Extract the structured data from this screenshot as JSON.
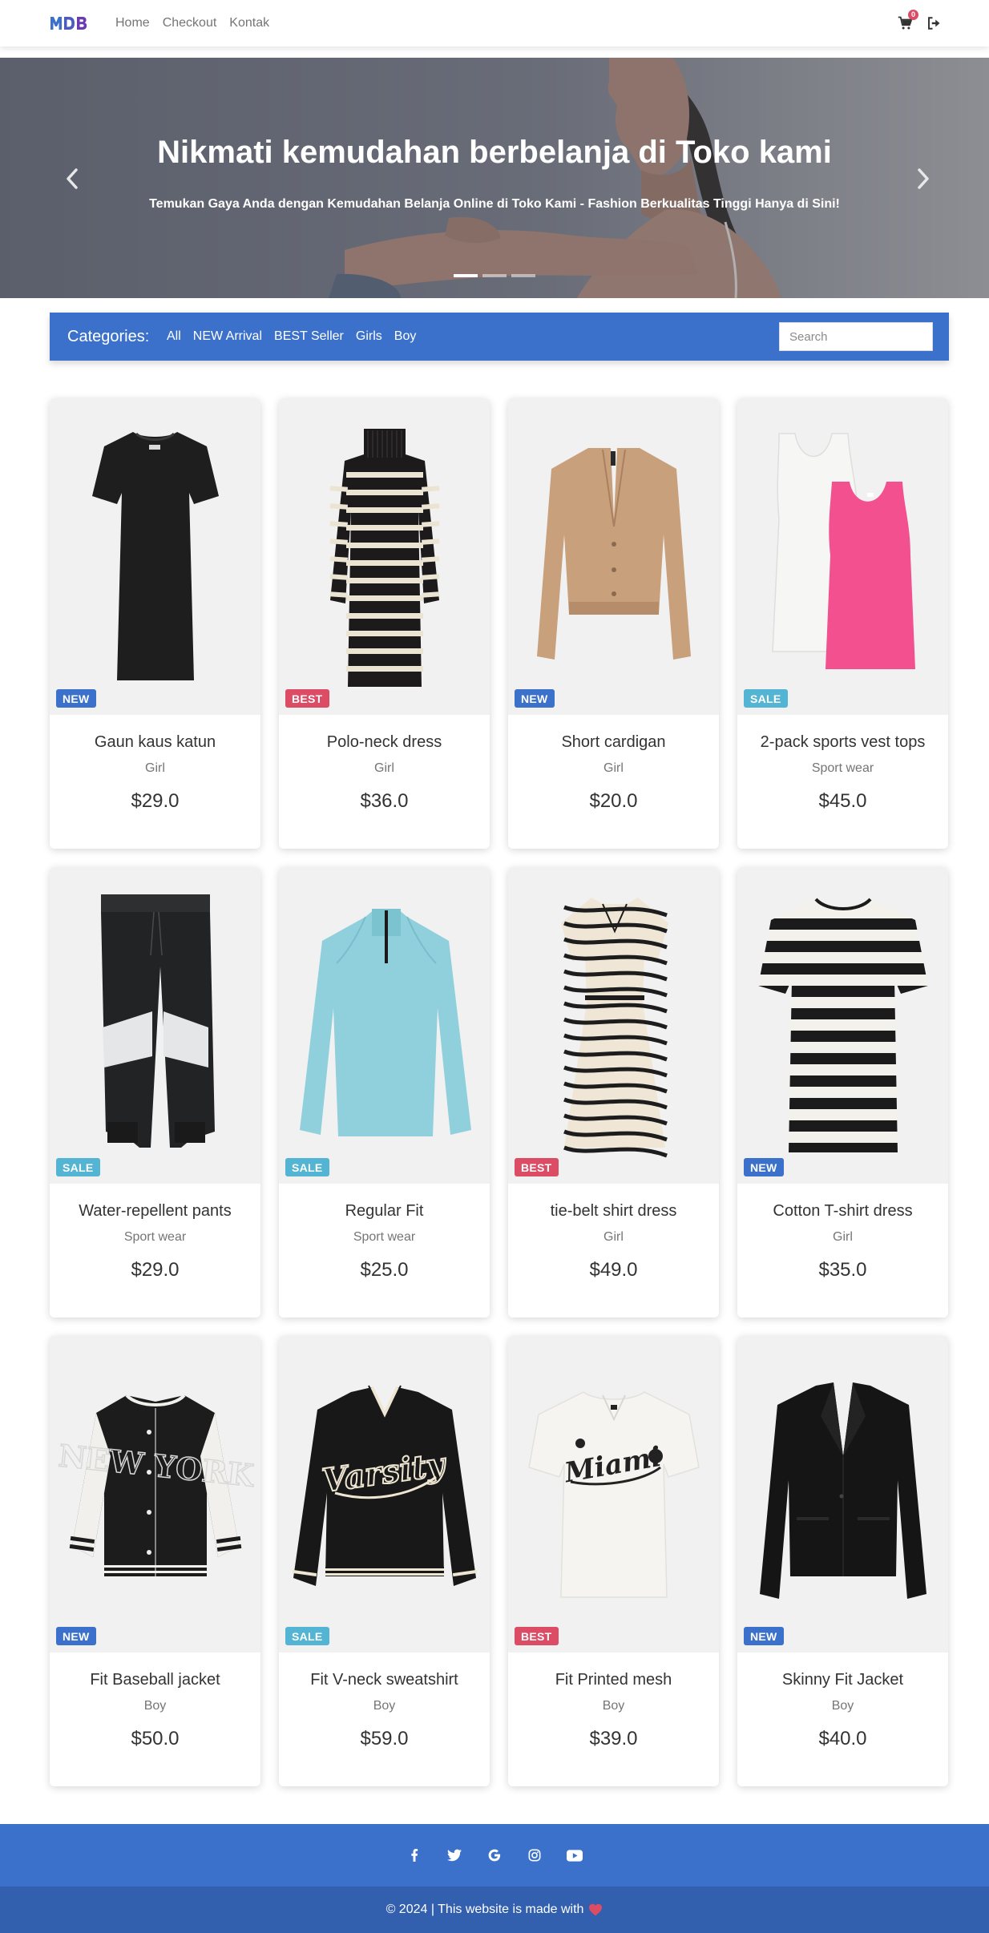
{
  "navbar": {
    "brand": "MDB",
    "links": [
      "Home",
      "Checkout",
      "Kontak"
    ],
    "cart_count": "0"
  },
  "hero": {
    "title": "Nikmati kemudahan berbelanja di Toko kami",
    "subtitle": "Temukan Gaya Anda dengan Kemudahan Belanja Online di Toko Kami - Fashion Berkualitas Tinggi Hanya di Sini!",
    "active_slide": 1,
    "slide_count": 3
  },
  "categories": {
    "label": "Categories:",
    "items": [
      "All",
      "NEW Arrival",
      "BEST Seller",
      "Girls",
      "Boy"
    ],
    "search_placeholder": "Search"
  },
  "badge_colors": {
    "NEW": "#3b71ca",
    "BEST": "#dc4c64",
    "SALE": "#54b4d3"
  },
  "products": [
    {
      "name": "Gaun kaus katun",
      "category": "Girl",
      "price": "$29.0",
      "badge": "NEW",
      "image": "black-tshirt-dress"
    },
    {
      "name": "Polo-neck dress",
      "category": "Girl",
      "price": "$36.0",
      "badge": "BEST",
      "image": "striped-knit-dress"
    },
    {
      "name": "Short cardigan",
      "category": "Girl",
      "price": "$20.0",
      "badge": "NEW",
      "image": "beige-cardigan"
    },
    {
      "name": "2-pack sports vest tops",
      "category": "Sport wear",
      "price": "$45.0",
      "badge": "SALE",
      "image": "sports-vest-tops"
    },
    {
      "name": "Water-repellent pants",
      "category": "Sport wear",
      "price": "$29.0",
      "badge": "SALE",
      "image": "black-track-pants"
    },
    {
      "name": "Regular Fit",
      "category": "Sport wear",
      "price": "$25.0",
      "badge": "SALE",
      "image": "light-blue-zip-top"
    },
    {
      "name": "tie-belt shirt dress",
      "category": "Girl",
      "price": "$49.0",
      "badge": "BEST",
      "image": "zebra-shirt-dress"
    },
    {
      "name": "Cotton T-shirt dress",
      "category": "Girl",
      "price": "$35.0",
      "badge": "NEW",
      "image": "striped-tshirt-dress"
    },
    {
      "name": "Fit Baseball jacket",
      "category": "Boy",
      "price": "$50.0",
      "badge": "NEW",
      "image": "baseball-jacket"
    },
    {
      "name": "Fit V-neck sweatshirt",
      "category": "Boy",
      "price": "$59.0",
      "badge": "SALE",
      "image": "varsity-sweatshirt"
    },
    {
      "name": "Fit Printed mesh",
      "category": "Boy",
      "price": "$39.0",
      "badge": "BEST",
      "image": "printed-mesh-tee"
    },
    {
      "name": "Skinny Fit Jacket",
      "category": "Boy",
      "price": "$40.0",
      "badge": "NEW",
      "image": "black-blazer"
    }
  ],
  "footer": {
    "social": [
      "facebook-icon",
      "twitter-icon",
      "google-icon",
      "instagram-icon",
      "youtube-icon"
    ],
    "copyright": "© 2024 | This website is made with",
    "heart_color": "#dc4c64"
  }
}
